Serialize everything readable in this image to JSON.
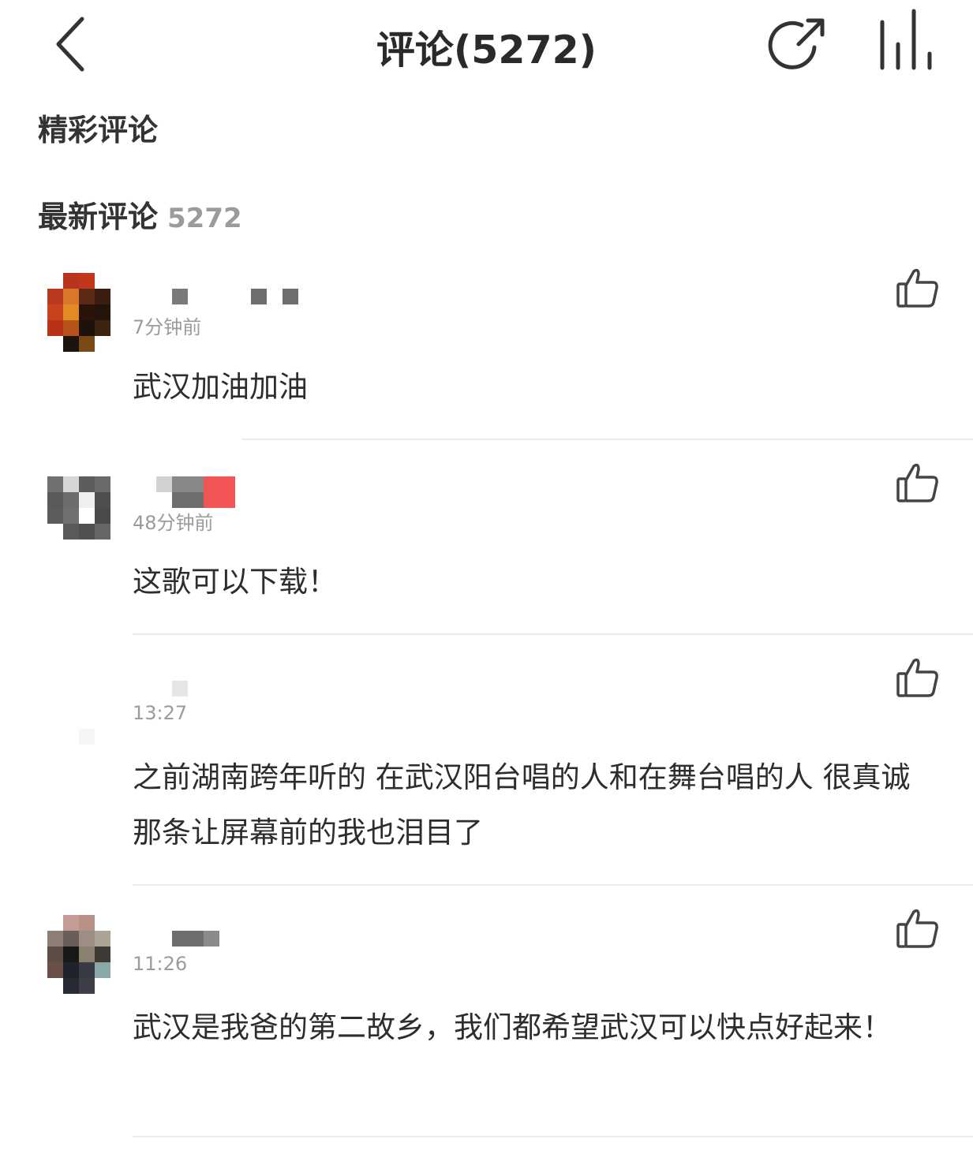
{
  "header": {
    "title": "评论(5272)",
    "back_icon": "chevron-left-icon",
    "share_icon": "share-icon",
    "stats_icon": "bar-chart-icon"
  },
  "sections": {
    "featured_label": "精彩评论",
    "latest_label": "最新评论",
    "latest_count": "5272"
  },
  "comments": [
    {
      "time": "7分钟前",
      "text": "武汉加油加油"
    },
    {
      "time": "48分钟前",
      "text": "这歌可以下载！"
    },
    {
      "time": "13:27",
      "text": "之前湖南跨年听的 在武汉阳台唱的人和在舞台唱的人 很真诚 那条让屏幕前的我也泪目了"
    },
    {
      "time": "11:26",
      "text": "武汉是我爸的第二故乡，我们都希望武汉可以快点好起来！"
    }
  ],
  "colors": {
    "text_primary": "#2d2d2d",
    "text_secondary": "#9b9b9b",
    "divider": "#ececec",
    "icon": "#333333"
  }
}
